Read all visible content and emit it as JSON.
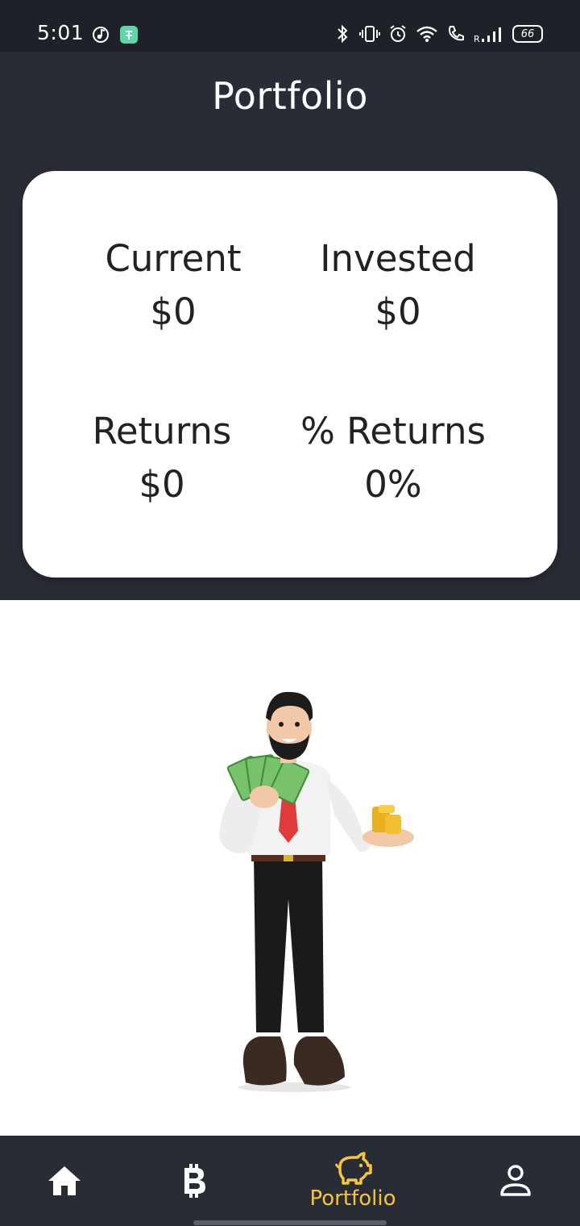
{
  "status_bar": {
    "time": "5:01",
    "battery": "66",
    "icons": [
      "music-note-icon",
      "app-notification-icon",
      "bluetooth-icon",
      "vibrate-icon",
      "alarm-icon",
      "wifi-icon",
      "call-icon",
      "signal-icon",
      "battery-icon"
    ]
  },
  "header": {
    "title": "Portfolio"
  },
  "stats": {
    "current": {
      "label": "Current",
      "value": "$0"
    },
    "invested": {
      "label": "Invested",
      "value": "$0"
    },
    "returns": {
      "label": "Returns",
      "value": "$0"
    },
    "percent_returns": {
      "label": "% Returns",
      "value": "0%"
    }
  },
  "nav": {
    "items": [
      {
        "icon": "home-icon"
      },
      {
        "icon": "bitcoin-icon"
      },
      {
        "icon": "piggy-bank-icon",
        "label": "Portfolio",
        "active": true
      },
      {
        "icon": "person-icon"
      }
    ]
  },
  "colors": {
    "header_bg": "#282c35",
    "status_bg": "#1e2228",
    "accent": "#f7c43c",
    "card_bg": "#ffffff"
  }
}
